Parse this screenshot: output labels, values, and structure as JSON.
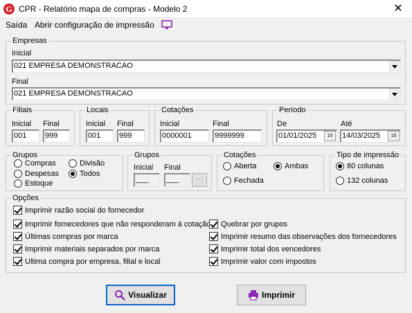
{
  "window": {
    "title": "CPR - Relatório mapa de compras - Modelo 2",
    "close_glyph": "✕"
  },
  "menu": {
    "saida": "Saída",
    "abrir": "Abrir configuração de impressão"
  },
  "empresas": {
    "legend": "Empresas",
    "inicial_label": "Inicial",
    "inicial_value": "021 EMPRESA DEMONSTRACAO",
    "final_label": "Final",
    "final_value": "021 EMPRESA DEMONSTRACAO"
  },
  "filiais": {
    "legend": "Filiais",
    "inicial_label": "Inicial",
    "inicial_value": "001",
    "final_label": "Final",
    "final_value": "999"
  },
  "locais": {
    "legend": "Locais",
    "inicial_label": "Inicial",
    "inicial_value": "001",
    "final_label": "Final",
    "final_value": "999"
  },
  "cotacoes_range": {
    "legend": "Cotações",
    "inicial_label": "Inicial",
    "inicial_value": "0000001",
    "final_label": "Final",
    "final_value": "9999999"
  },
  "periodo": {
    "legend": "Período",
    "de_label": "De",
    "de_value": "01/01/2025",
    "ate_label": "Até",
    "ate_value": "14/03/2025",
    "cal_glyph": "15"
  },
  "grupos_radio": {
    "legend": "Grupos",
    "options": [
      "Compras",
      "Despesas",
      "Estoque",
      "Divisão",
      "Todos"
    ],
    "selected": "Todos"
  },
  "grupos_range": {
    "legend": "Grupos",
    "inicial_label": "Inicial",
    "final_label": "Final",
    "inicial_value": "___",
    "final_value": "___",
    "dots": "···"
  },
  "cotacoes_radio": {
    "legend": "Cotações",
    "options": [
      "Aberta",
      "Ambas",
      "Fechada"
    ],
    "selected": "Ambas"
  },
  "tipo_impressao": {
    "legend": "Tipo de impressão",
    "options": [
      "80 colunas",
      "132 colunas"
    ],
    "selected": "80 colunas"
  },
  "opcoes": {
    "legend": "Opções",
    "left": [
      {
        "label": "Imprimir razão social do fornecedor",
        "checked": true
      },
      {
        "label": "Imprimir fornecedores que não responderam à cotação",
        "checked": true
      },
      {
        "label": "Últimas compras por marca",
        "checked": true
      },
      {
        "label": "Imprimir materiais separados por marca",
        "checked": true
      },
      {
        "label": "Ultima compra por empresa, filial e local",
        "checked": true
      }
    ],
    "right": [
      {
        "label": "Quebrar por grupos",
        "checked": true
      },
      {
        "label": "Imprimir resumo das observações dos fornecedores",
        "checked": true
      },
      {
        "label": "Imprimir total dos vencedores",
        "checked": true
      },
      {
        "label": "Imprimir valor com impostos",
        "checked": true
      }
    ]
  },
  "buttons": {
    "visualizar": "Visualizar",
    "imprimir": "Imprimir"
  },
  "colors": {
    "accent": "#0a64c8",
    "brand": "#d2232a",
    "icon_purple": "#8c28b4"
  }
}
